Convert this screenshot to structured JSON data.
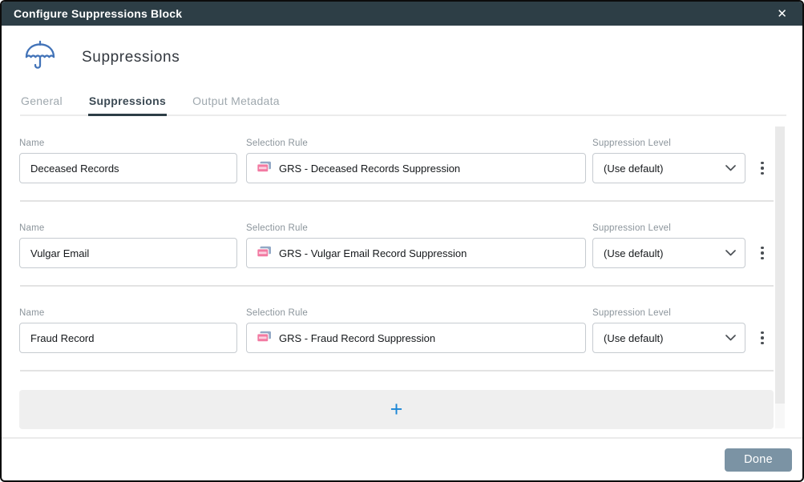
{
  "dialog": {
    "title": "Configure Suppressions Block",
    "close_icon": "✕",
    "heading": "Suppressions",
    "done_label": "Done"
  },
  "tabs": [
    {
      "label": "General",
      "active": false
    },
    {
      "label": "Suppressions",
      "active": true
    },
    {
      "label": "Output Metadata",
      "active": false
    }
  ],
  "field_labels": {
    "name": "Name",
    "selection_rule": "Selection Rule",
    "suppression_level": "Suppression Level"
  },
  "rows": [
    {
      "name": "Deceased Records",
      "selection_rule": "GRS - Deceased Records Suppression",
      "suppression_level": "(Use default)"
    },
    {
      "name": "Vulgar Email",
      "selection_rule": "GRS - Vulgar Email Record Suppression",
      "suppression_level": "(Use default)"
    },
    {
      "name": "Fraud Record",
      "selection_rule": "GRS - Fraud Record Suppression",
      "suppression_level": "(Use default)"
    }
  ],
  "add": {
    "plus_icon": "+"
  },
  "icons": {
    "umbrella": "umbrella-icon",
    "rule": "rule-card-icon",
    "kebab": "kebab-menu-icon",
    "chevron": "chevron-down-icon"
  },
  "colors": {
    "header_bg": "#2d3e46",
    "accent_blue": "#1b87d6",
    "umbrella_blue": "#4273b8",
    "rule_icon_pink": "#f27aa2",
    "done_button_bg": "#7b93a4"
  }
}
